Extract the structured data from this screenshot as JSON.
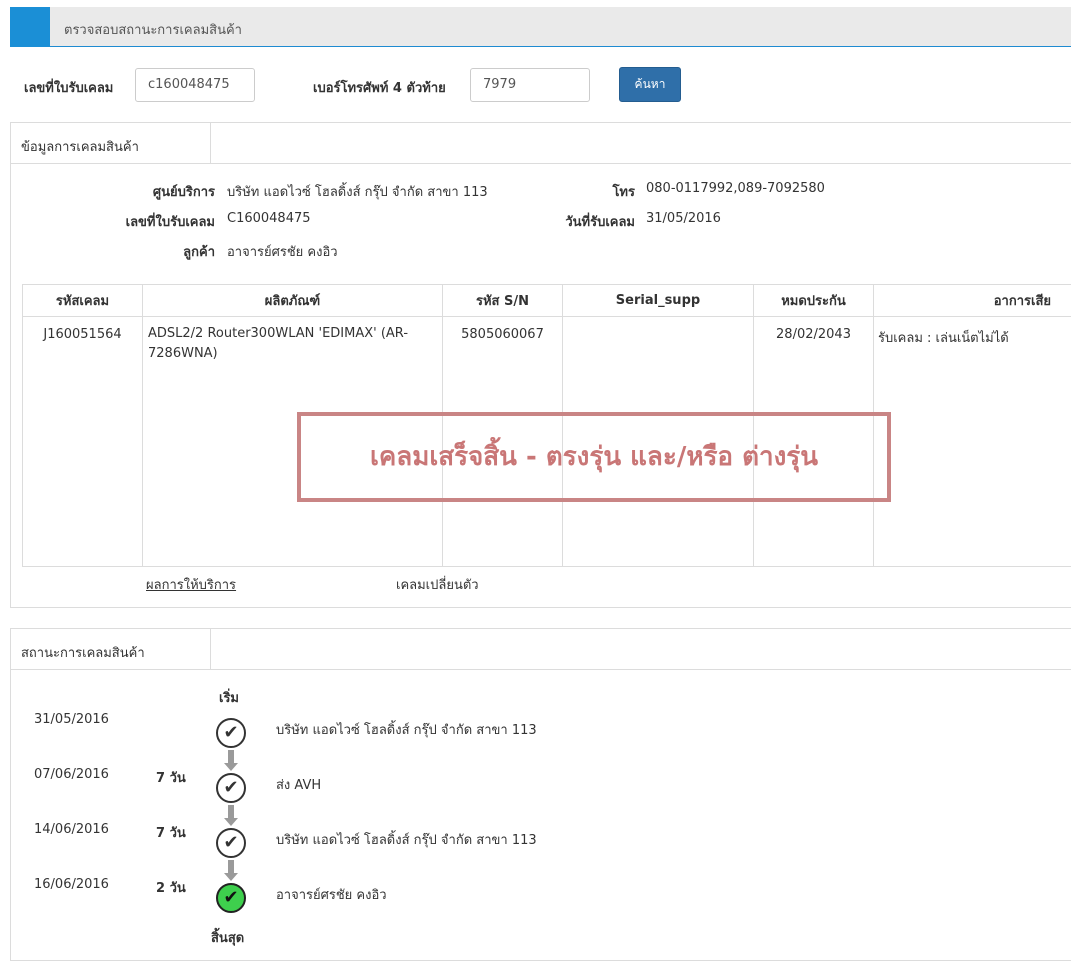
{
  "header": {
    "title": "ตรวจสอบสถานะการเคลมสินค้า"
  },
  "search": {
    "receipt_label": "เลขที่ใบรับเคลม",
    "receipt_value": "c160048475",
    "phone_label": "เบอร์โทรศัพท์ 4 ตัวท้าย",
    "phone_value": "7979",
    "search_button": "ค้นหา"
  },
  "info_panel": {
    "tab": "ข้อมูลการเคลมสินค้า",
    "service_center_label": "ศูนย์บริการ",
    "service_center_value": "บริษัท แอดไวซ์ โฮลดิ้งส์ กรุ๊ป จำกัด สาขา 113",
    "phone_label": "โทร",
    "phone_value": "080-0117992,089-7092580",
    "receipt_label": "เลขที่ใบรับเคลม",
    "receipt_value": "C160048475",
    "date_label": "วันที่รับเคลม",
    "date_value": "31/05/2016",
    "customer_label": "ลูกค้า",
    "customer_value": "อาจารย์ศรชัย คงอิว"
  },
  "table": {
    "headers": [
      "รหัสเคลม",
      "ผลิตภัณฑ์",
      "รหัส S/N",
      "Serial_supp",
      "หมดประกัน",
      "อาการเสีย"
    ],
    "row": {
      "claim_id": "J160051564",
      "product": "ADSL2/2 Router300WLAN 'EDIMAX' (AR-7286WNA)",
      "sn": "5805060067",
      "serial_supp": "",
      "warranty": "28/02/2043",
      "symptom": "รับเคลม : เล่นเน็ตไม่ได้"
    }
  },
  "stamp": "เคลมเสร็จสิ้น - ตรงรุ่น และ/หรือ ต่างรุ่น",
  "links": {
    "service_result": "ผลการให้บริการ",
    "claim_change": "เคลมเปลี่ยนตัว"
  },
  "status_panel": {
    "tab": "สถานะการเคลมสินค้า",
    "start_label": "เริ่ม",
    "end_label": "สิ้นสุด",
    "steps": [
      {
        "date": "31/05/2016",
        "days": "",
        "desc": "บริษัท แอดไวซ์ โฮลดิ้งส์ กรุ๊ป จำกัด สาขา 113"
      },
      {
        "date": "07/06/2016",
        "days": "7 วัน",
        "desc": "ส่ง AVH"
      },
      {
        "date": "14/06/2016",
        "days": "7 วัน",
        "desc": "บริษัท แอดไวซ์ โฮลดิ้งส์ กรุ๊ป จำกัด สาขา 113"
      },
      {
        "date": "16/06/2016",
        "days": "2 วัน",
        "desc": "อาจารย์ศรชัย คงอิว"
      }
    ]
  }
}
